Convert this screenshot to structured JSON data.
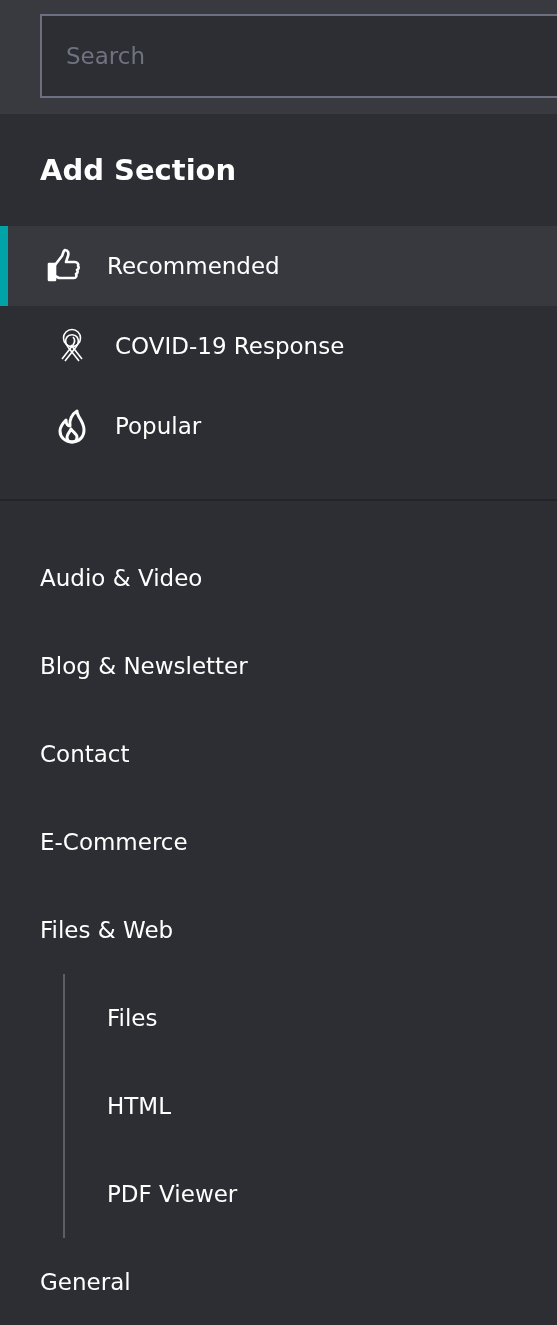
{
  "search": {
    "placeholder": "Search"
  },
  "heading": "Add Section",
  "featured": [
    {
      "label": "Recommended",
      "selected": true
    },
    {
      "label": "COVID-19 Response",
      "selected": false
    },
    {
      "label": "Popular",
      "selected": false
    }
  ],
  "categories": [
    {
      "label": "Audio & Video"
    },
    {
      "label": "Blog & Newsletter"
    },
    {
      "label": "Contact"
    },
    {
      "label": "E-Commerce"
    },
    {
      "label": "Files & Web",
      "children": [
        {
          "label": "Files"
        },
        {
          "label": "HTML"
        },
        {
          "label": "PDF Viewer"
        }
      ]
    },
    {
      "label": "General"
    }
  ]
}
